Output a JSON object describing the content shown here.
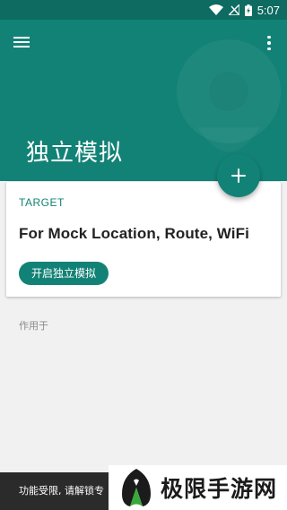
{
  "status_bar": {
    "time": "5:07",
    "icons": [
      "wifi-icon",
      "signal-off-icon",
      "battery-charging-icon"
    ]
  },
  "header": {
    "title": "独立模拟",
    "menu_icon": "hamburger-menu-icon",
    "more_icon": "more-vertical-icon"
  },
  "fab": {
    "icon": "plus-icon"
  },
  "card": {
    "overline": "TARGET",
    "title": "For Mock Location, Route, WiFi",
    "action_label": "开启独立模拟"
  },
  "section": {
    "label": "作用于"
  },
  "toast": {
    "text": "功能受限, 请解锁专"
  },
  "watermark": {
    "text": "极限手游网"
  },
  "colors": {
    "primary": "#138276",
    "status_bar": "#0d6b61",
    "background": "#f1f1f1",
    "toast": "#2b2b2b"
  }
}
